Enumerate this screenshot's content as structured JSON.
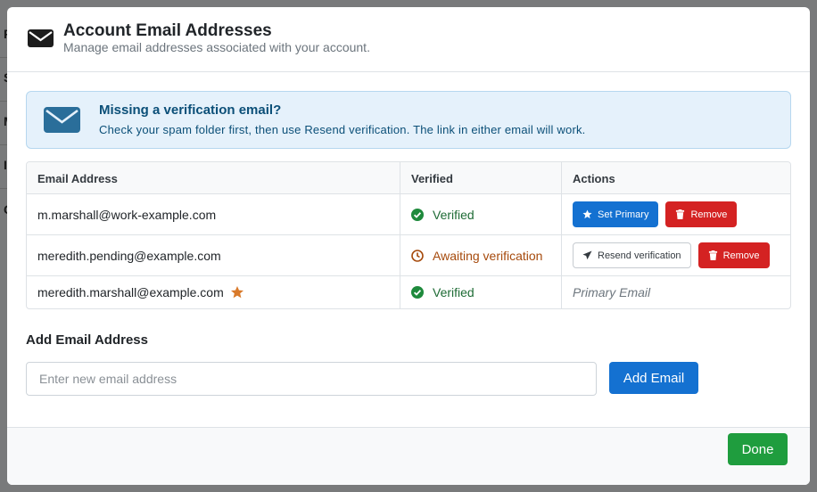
{
  "background": {
    "letters": [
      "P",
      "S",
      "M",
      "I",
      "C"
    ]
  },
  "modal": {
    "title": "Account Email Addresses",
    "subtitle": "Manage email addresses associated with your account.",
    "header_icon": "envelope-icon"
  },
  "alert": {
    "icon": "envelope-icon",
    "title": "Missing a verification email?",
    "text": "Check your spam folder first, then use Resend verification. The link in either email will work."
  },
  "table": {
    "columns": [
      "Email Address",
      "Verified",
      "Actions"
    ],
    "rows": [
      {
        "email": "m.marshall@work-example.com",
        "status": "Verified",
        "status_icon": "check-circle-icon",
        "actions": [
          "Set Primary",
          "Remove"
        ]
      },
      {
        "email": "meredith.pending@example.com",
        "status": "Awaiting verification",
        "status_icon": "clock-icon",
        "actions": [
          "Resend verification",
          "Remove"
        ]
      },
      {
        "email": "meredith.marshall@example.com",
        "primary_icon": "star-icon",
        "status": "Verified",
        "status_icon": "check-circle-icon",
        "primary_label": "Primary Email"
      }
    ]
  },
  "add_email": {
    "label": "Add Email Address",
    "placeholder": "Enter new email address",
    "button": "Add Email"
  },
  "footer": {
    "done": "Done"
  },
  "colors": {
    "primary": "#1471d1",
    "danger": "#d42222",
    "success": "#1f9d3e",
    "verified_text": "#1e6b35",
    "pending_text": "#a64a0c",
    "star": "#d97a2b"
  }
}
